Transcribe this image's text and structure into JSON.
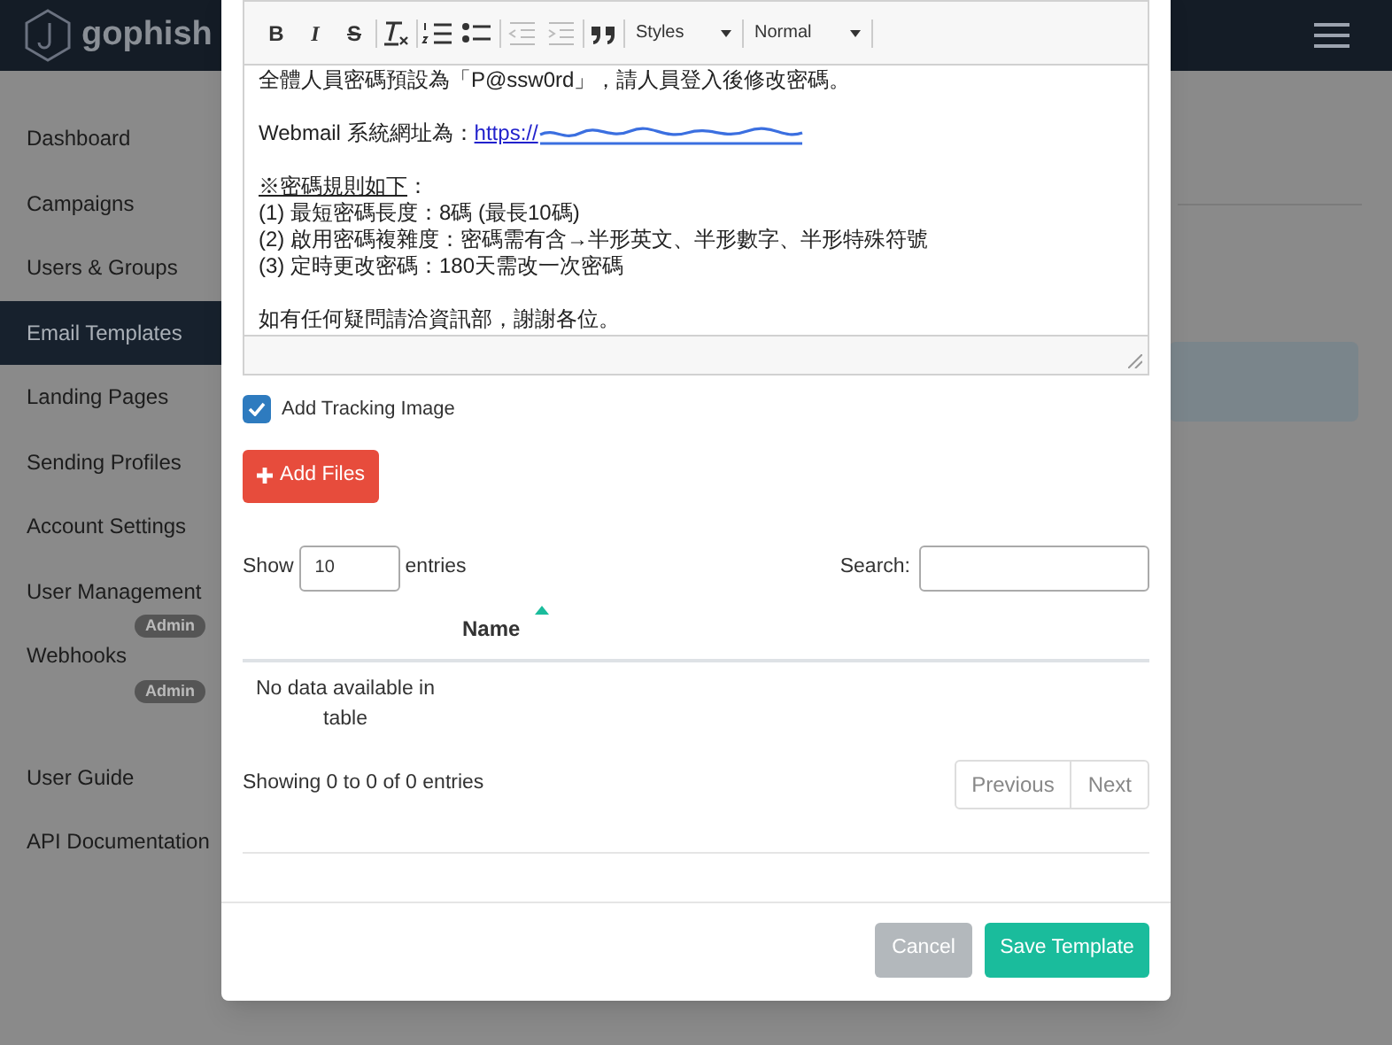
{
  "navbar": {
    "brand": "gophish"
  },
  "sidebar": {
    "items": [
      {
        "label": "Dashboard",
        "selected": false
      },
      {
        "label": "Campaigns",
        "selected": false
      },
      {
        "label": "Users & Groups",
        "selected": false
      },
      {
        "label": "Email Templates",
        "selected": true
      },
      {
        "label": "Landing Pages",
        "selected": false
      },
      {
        "label": "Sending Profiles",
        "selected": false
      },
      {
        "label": "Account Settings",
        "selected": false
      },
      {
        "label": "User Management",
        "selected": false,
        "badge": "Admin"
      },
      {
        "label": "Webhooks",
        "selected": false,
        "badge": "Admin"
      },
      {
        "label": "User Guide",
        "selected": false
      },
      {
        "label": "API Documentation",
        "selected": false
      }
    ]
  },
  "editor": {
    "toolbar": {
      "bold": "B",
      "italic": "I",
      "strike": "S",
      "styles": "Styles",
      "format": "Normal"
    },
    "lines": [
      {
        "kind": "text",
        "text": "全體人員密碼預設為「P@ssw0rd」，請人員登入後修改密碼。"
      },
      {
        "kind": "blank"
      },
      {
        "kind": "link",
        "text": "Webmail 系統網址為：",
        "link": "https://"
      },
      {
        "kind": "blank"
      },
      {
        "kind": "heading",
        "text": "※密碼規則如下",
        "suffix": "："
      },
      {
        "kind": "text",
        "text": "(1) 最短密碼長度：8碼 (最長10碼)"
      },
      {
        "kind": "text",
        "text": "(2) 啟用密碼複雜度：密碼需有含→半形英文、半形數字、半形特殊符號"
      },
      {
        "kind": "text",
        "text": "(3) 定時更改密碼：180天需改一次密碼"
      },
      {
        "kind": "blank"
      },
      {
        "kind": "text",
        "text": "如有任何疑問請洽資訊部，謝謝各位。"
      }
    ]
  },
  "tracking": {
    "label": "Add Tracking Image",
    "checked": true
  },
  "add_files": "Add Files",
  "attachments": {
    "show_label": "Show",
    "page_size": "10",
    "entries_label": "entries",
    "search_label": "Search:",
    "columns": [
      "Name"
    ],
    "empty": "No data available in table",
    "info": "Showing 0 to 0 of 0 entries",
    "previous": "Previous",
    "next": "Next"
  },
  "buttons": {
    "cancel": "Cancel",
    "save": "Save Template"
  }
}
